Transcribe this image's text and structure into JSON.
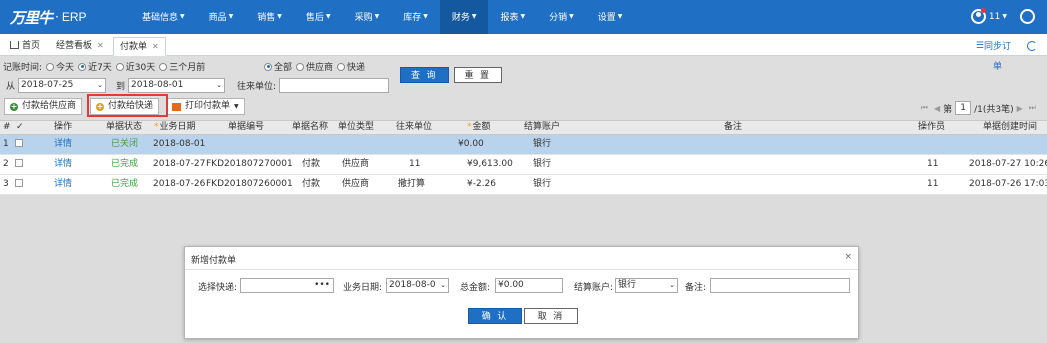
{
  "brand": {
    "logo_text": "万里牛",
    "product": "ERP"
  },
  "nav": {
    "items": [
      {
        "label": "基础信息"
      },
      {
        "label": "商品"
      },
      {
        "label": "销售"
      },
      {
        "label": "售后"
      },
      {
        "label": "采购"
      },
      {
        "label": "库存"
      },
      {
        "label": "财务"
      },
      {
        "label": "报表"
      },
      {
        "label": "分销"
      },
      {
        "label": "设置"
      }
    ],
    "active": "财务",
    "user_label": "11"
  },
  "tabs": {
    "items": [
      {
        "label": "首页"
      },
      {
        "label": "经营看板"
      },
      {
        "label": "付款单"
      }
    ],
    "sync_label": "同步订",
    "sync_icon": "list-icon"
  },
  "filters": {
    "period_label": "记账时间:",
    "period_options": [
      "今天",
      "近7天",
      "近30天",
      "三个月前"
    ],
    "period_selected": "近7天",
    "scope_options": [
      "全部",
      "供应商",
      "快递"
    ],
    "scope_selected": "全部",
    "from_label": "从",
    "from_date": "2018-07-25",
    "to_label": "到",
    "to_date": "2018-08-01",
    "partner_label": "往来单位:",
    "query_button": "查 询",
    "reset_button": "重 置",
    "single_link": "单"
  },
  "toolbar": {
    "pay_supplier": "付款给供应商",
    "pay_express": "付款给快递",
    "print": "打印付款单"
  },
  "pager": {
    "page_label": "第",
    "page_value": "1",
    "page_total": "/1(共3笔)"
  },
  "grid": {
    "headers": {
      "num": "#",
      "check": "✓",
      "action": "操作",
      "status": "单据状态",
      "date": "业务日期",
      "doc_no": "单据编号",
      "doc_name": "单据名称",
      "party_type": "单位类型",
      "party": "往来单位",
      "amount": "金额",
      "account": "结算账户",
      "remark": "备注",
      "operator": "操作员",
      "created": "单据创建时间"
    },
    "rows": [
      {
        "num": "1",
        "action": "详情",
        "status": "已关闭",
        "date": "2018-08-01",
        "doc_no": "",
        "doc_name": "",
        "party_type": "",
        "party": "",
        "amount": "¥0.00",
        "account": "银行",
        "remark": "",
        "operator": "",
        "created": ""
      },
      {
        "num": "2",
        "action": "详情",
        "status": "已完成",
        "date": "2018-07-27",
        "doc_no": "FKD201807270001",
        "doc_name": "付款",
        "party_type": "供应商",
        "party": "11",
        "amount": "¥9,613.00",
        "account": "银行",
        "remark": "",
        "operator": "11",
        "created": "2018-07-27 10:26"
      },
      {
        "num": "3",
        "action": "详情",
        "status": "已完成",
        "date": "2018-07-26",
        "doc_no": "FKD201807260001",
        "doc_name": "付款",
        "party_type": "供应商",
        "party": "撒打算",
        "amount": "¥-2.26",
        "account": "银行",
        "remark": "",
        "operator": "11",
        "created": "2018-07-26 17:03"
      }
    ]
  },
  "dialog": {
    "title": "新增付款单",
    "close": "×",
    "express_label": "选择快递:",
    "express_value": "",
    "express_more": "•••",
    "date_label": "业务日期:",
    "date_value": "2018-08-0",
    "total_label": "总金额:",
    "total_value": "¥0.00",
    "account_label": "结算账户:",
    "account_value": "银行",
    "remark_label": "备注:",
    "remark_value": "",
    "confirm": "确 认",
    "cancel": "取 消"
  },
  "colors": {
    "primary": "#1f6fc4",
    "nav_active": "#14589f",
    "highlight": "#e53935",
    "selected_row": "#b9d3ec"
  }
}
